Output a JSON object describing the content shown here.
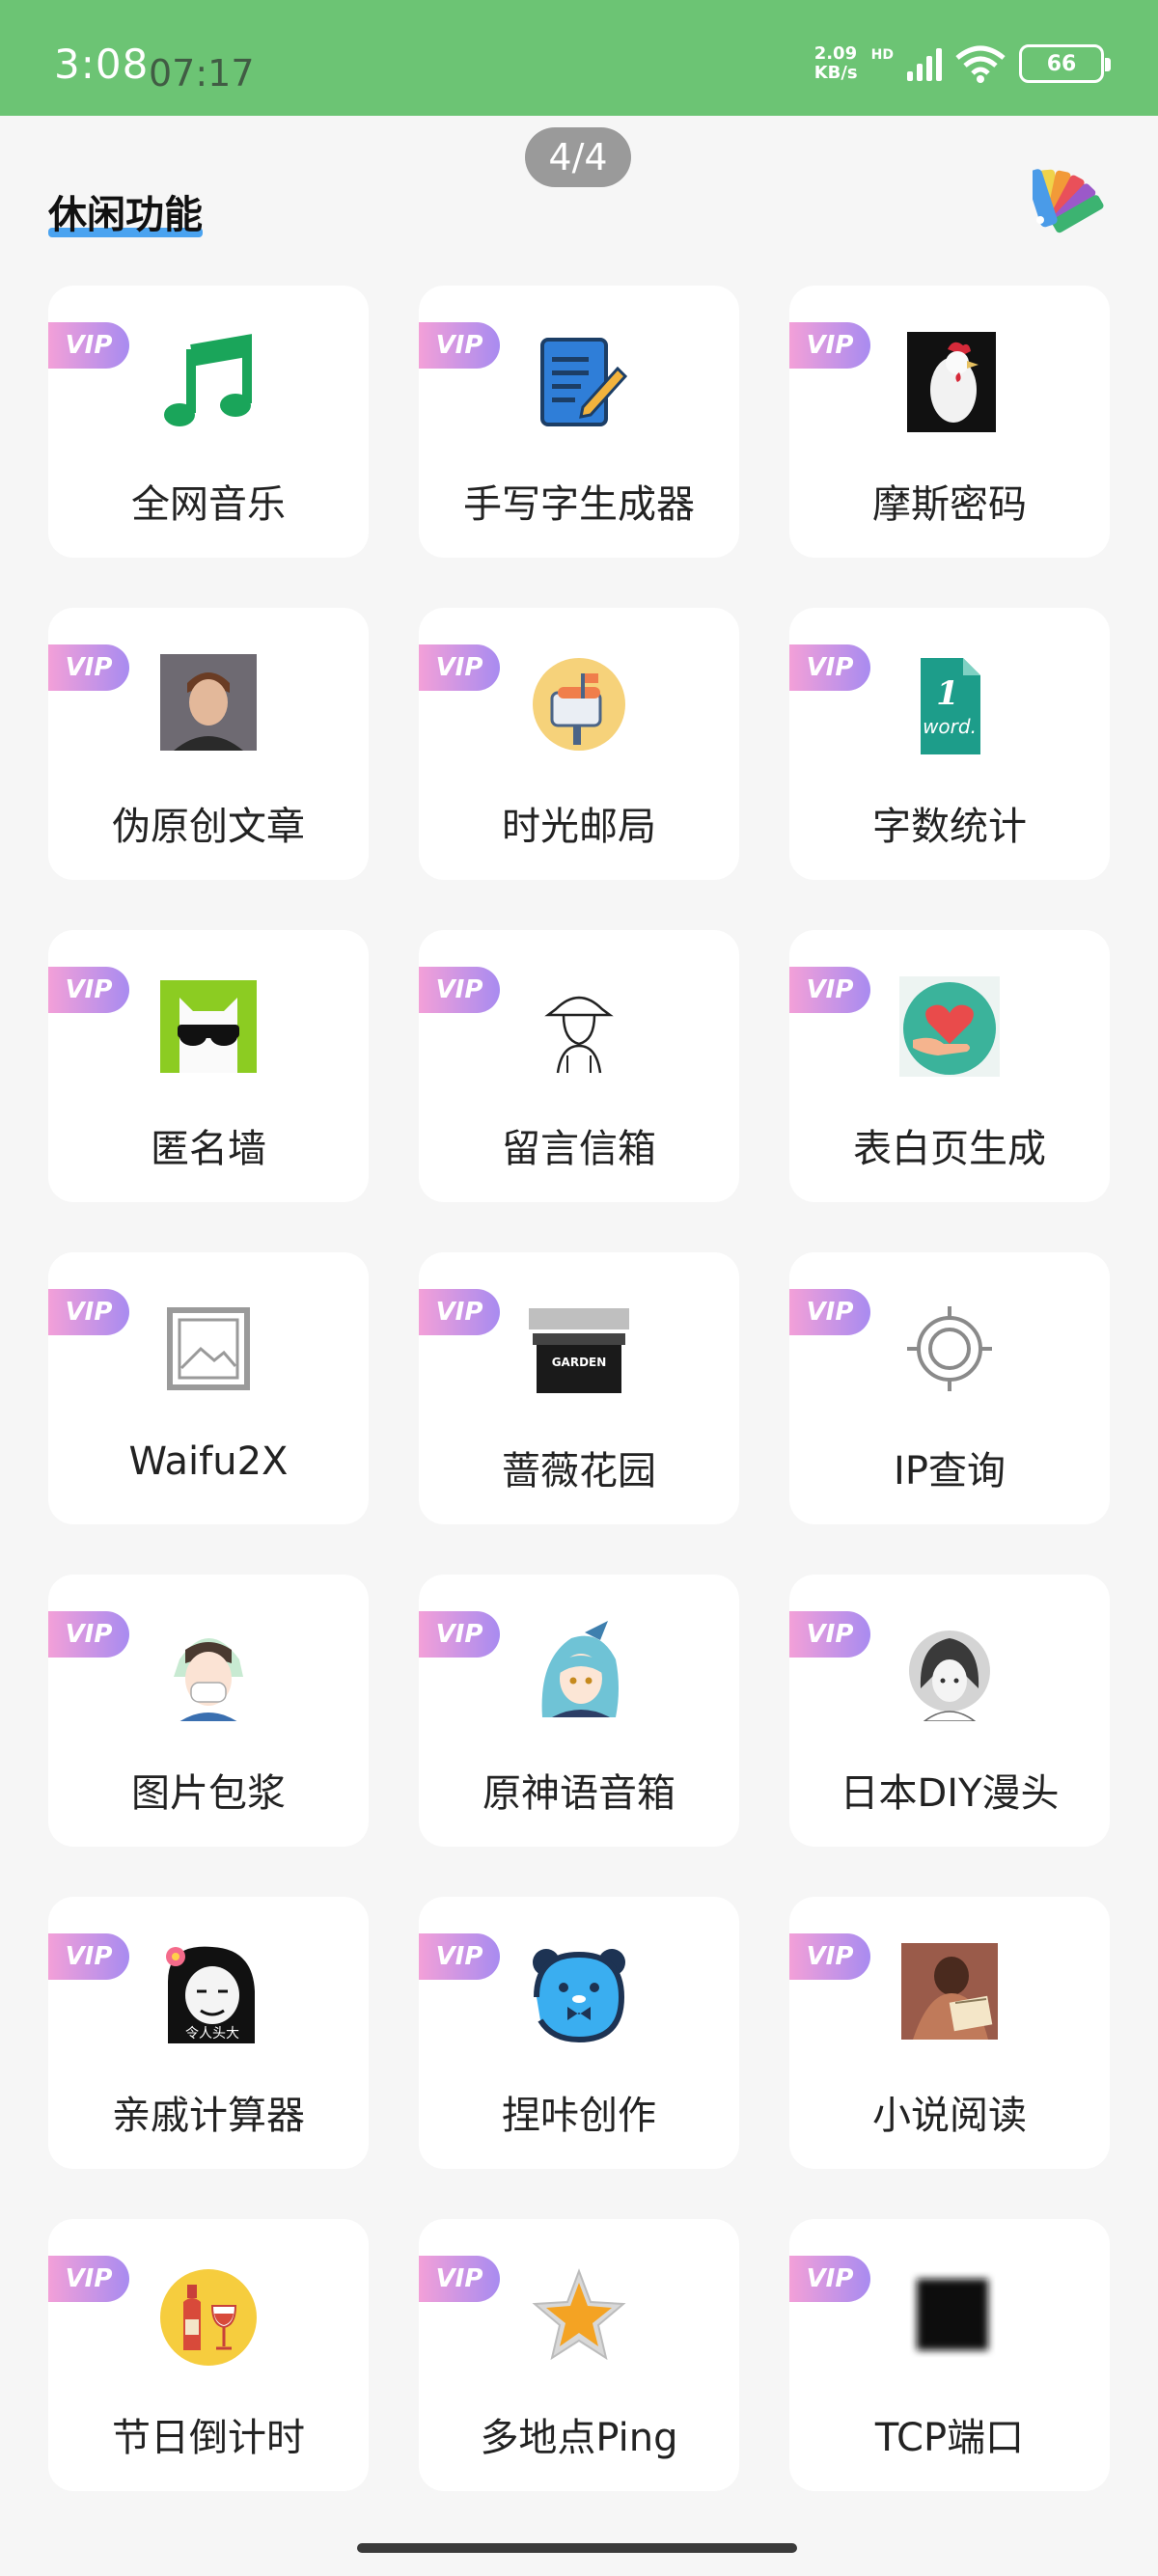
{
  "status": {
    "time": "3:08",
    "time_overlay": "07:17",
    "net_speed_value": "2.09",
    "net_speed_unit": "KB/s",
    "hd": "HD",
    "battery": "66"
  },
  "page_indicator": "4/4",
  "section_title": "休闲功能",
  "vip_label": "VIP",
  "cards": [
    {
      "label": "全网音乐",
      "icon": "music-note-icon"
    },
    {
      "label": "手写字生成器",
      "icon": "handwriting-doc-icon"
    },
    {
      "label": "摩斯密码",
      "icon": "rooster-icon"
    },
    {
      "label": "伪原创文章",
      "icon": "singer-photo-icon"
    },
    {
      "label": "时光邮局",
      "icon": "mailbox-icon"
    },
    {
      "label": "字数统计",
      "icon": "word-file-icon"
    },
    {
      "label": "匿名墙",
      "icon": "cool-cat-icon"
    },
    {
      "label": "留言信箱",
      "icon": "sketch-person-icon"
    },
    {
      "label": "表白页生成",
      "icon": "heart-hand-icon"
    },
    {
      "label": "Waifu2X",
      "icon": "image-placeholder-icon"
    },
    {
      "label": "蔷薇花园",
      "icon": "garden-sign-icon"
    },
    {
      "label": "IP查询",
      "icon": "target-icon"
    },
    {
      "label": "图片包浆",
      "icon": "masked-girl-icon"
    },
    {
      "label": "原神语音箱",
      "icon": "anime-character-icon"
    },
    {
      "label": "日本DIY漫头",
      "icon": "anime-sketch-icon"
    },
    {
      "label": "亲戚计算器",
      "icon": "meme-face-icon"
    },
    {
      "label": "捏咔创作",
      "icon": "blue-bear-icon"
    },
    {
      "label": "小说阅读",
      "icon": "reading-man-icon"
    },
    {
      "label": "节日倒计时",
      "icon": "wine-icon"
    },
    {
      "label": "多地点Ping",
      "icon": "star-icon"
    },
    {
      "label": "TCP端口",
      "icon": "black-square-icon"
    }
  ]
}
